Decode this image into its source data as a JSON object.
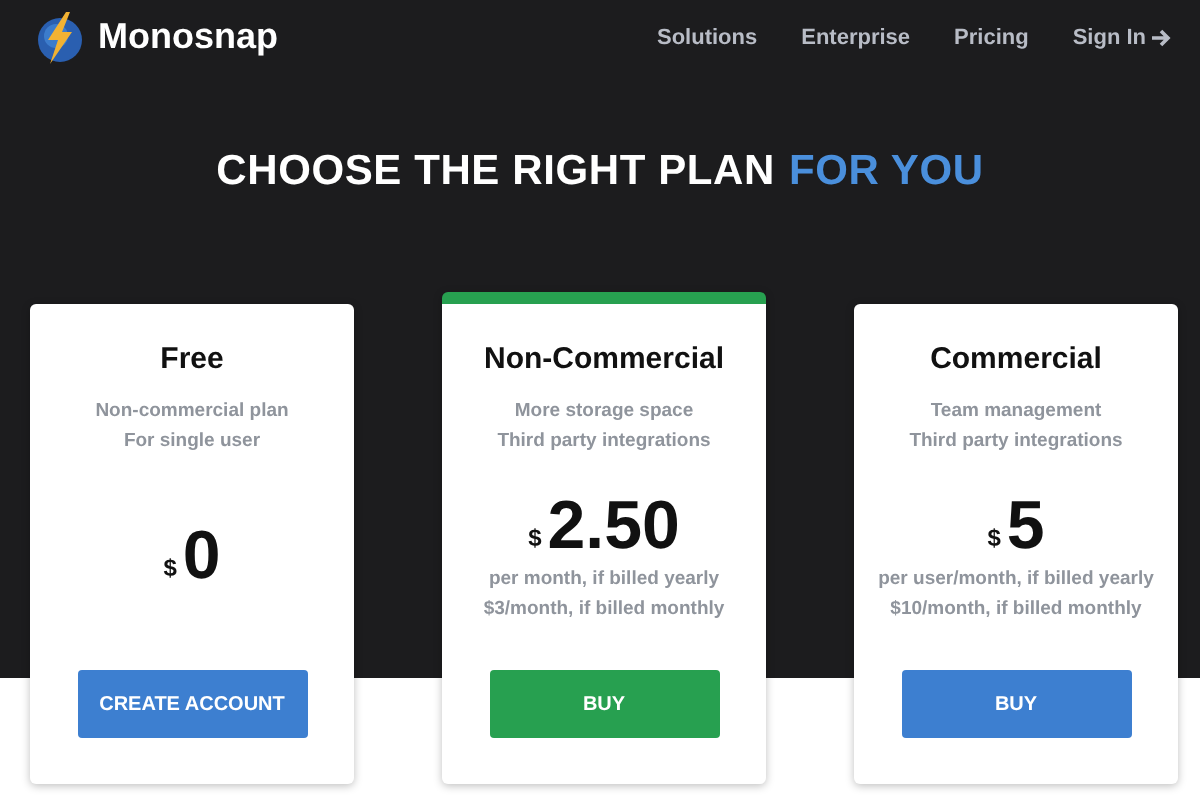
{
  "header": {
    "brand": "Monosnap",
    "nav": [
      "Solutions",
      "Enterprise",
      "Pricing",
      "Sign In"
    ]
  },
  "heading": {
    "text": "CHOOSE THE RIGHT PLAN",
    "highlight": "FOR YOU"
  },
  "plans": [
    {
      "name": "Free",
      "featured": false,
      "features": [
        "Non-commercial plan",
        "For single user"
      ],
      "currency": "$",
      "price": "0",
      "button": "CREATE ACCOUNT"
    },
    {
      "name": "Non-Commercial",
      "featured": true,
      "features": [
        "More storage space",
        "Third party integrations"
      ],
      "currency": "$",
      "price": "2.50",
      "notes": [
        "per month, if billed yearly",
        "$3/month, if billed monthly"
      ],
      "button": "BUY"
    },
    {
      "name": "Commercial",
      "featured": false,
      "features": [
        "Team management",
        "Third party integrations"
      ],
      "currency": "$",
      "price": "5",
      "notes": [
        "per user/month, if billed yearly",
        "$10/month, if billed monthly"
      ],
      "button": "BUY"
    }
  ]
}
